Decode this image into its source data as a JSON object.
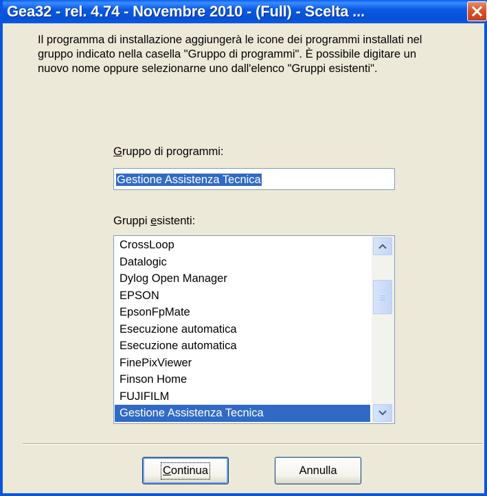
{
  "window": {
    "title": "Gea32 - rel. 4.74 - Novembre  2010 - (Full) - Scelta ..."
  },
  "description": "Il programma di installazione aggiungerà le icone dei programmi installati nel gruppo indicato nella casella \"Gruppo di programmi\". È possibile digitare un nuovo nome oppure selezionarne uno dall'elenco \"Gruppi esistenti\".",
  "program_group": {
    "label_mnemonic": "G",
    "label_rest": "ruppo di programmi:",
    "value": "Gestione Assistenza Tecnica"
  },
  "existing_groups": {
    "label_before": "Gruppi ",
    "label_mnemonic": "e",
    "label_after": "sistenti:",
    "items": [
      "CrossLoop",
      "Datalogic",
      "Dylog Open Manager",
      "EPSON",
      "EpsonFpMate",
      "Esecuzione automatica",
      "Esecuzione automatica",
      "FinePixViewer",
      "Finson Home",
      "FUJIFILM",
      "Gestione Assistenza Tecnica"
    ],
    "selected_index": 10
  },
  "buttons": {
    "continue_mnemonic": "C",
    "continue_rest": "ontinua",
    "cancel_label": "Annulla"
  },
  "colors": {
    "titlebar": "#0A5AE4",
    "selection": "#316AC5",
    "close_button": "#D8552E"
  },
  "icons": {
    "close": "close-icon",
    "scroll_up": "arrow-up-icon",
    "scroll_down": "arrow-down-icon",
    "thumb_grip": "grip-icon"
  }
}
